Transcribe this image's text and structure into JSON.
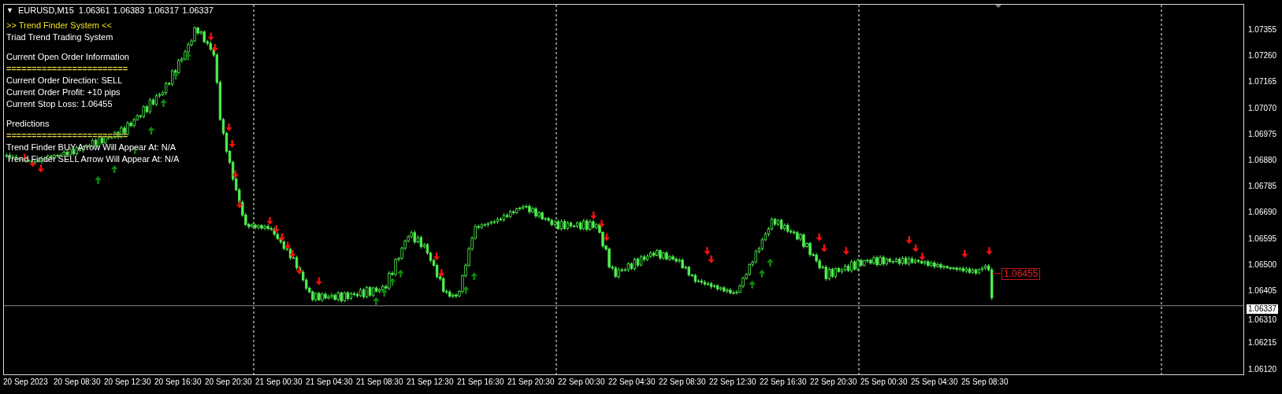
{
  "header": {
    "menu_glyph": "▼",
    "symbol": "EURUSD,M15",
    "quotes": [
      "1.06361",
      "1.06383",
      "1.06317",
      "1.06337"
    ]
  },
  "info_sections": [
    {
      "lines": [
        {
          "kind": "title",
          "text": ">> Trend Finder System <<"
        },
        {
          "kind": "text",
          "text": "Triad Trend Trading System"
        }
      ]
    },
    {
      "lines": [
        {
          "kind": "text",
          "text": "Current Open Order Information"
        },
        {
          "kind": "rule",
          "text": "========================"
        },
        {
          "kind": "text",
          "text": "Current Order Direction: SELL"
        },
        {
          "kind": "text",
          "text": "Current Order Profit: +10 pips"
        },
        {
          "kind": "text",
          "text": "Current Stop Loss: 1.06455"
        }
      ]
    },
    {
      "lines": [
        {
          "kind": "text",
          "text": "Predictions"
        },
        {
          "kind": "rule",
          "text": "========================"
        },
        {
          "kind": "text",
          "text": "Trend Finder BUY Arrow Will Appear At: N/A"
        },
        {
          "kind": "text",
          "text": "Trend Finder SELL Arrow Will Appear At: N/A"
        }
      ]
    }
  ],
  "stop_loss_label": "1.06455",
  "price_axis": {
    "ticks": [
      "1.07355",
      "1.07260",
      "1.07165",
      "1.07070",
      "1.06975",
      "1.06880",
      "1.06785",
      "1.06690",
      "1.06595",
      "1.06500",
      "1.06405",
      "1.06310",
      "1.06215",
      "1.06120"
    ],
    "current_price": "1.06337"
  },
  "time_axis": {
    "labels": [
      "20 Sep 2023",
      "20 Sep 08:30",
      "20 Sep 12:30",
      "20 Sep 16:30",
      "20 Sep 20:30",
      "21 Sep 00:30",
      "21 Sep 04:30",
      "21 Sep 08:30",
      "21 Sep 12:30",
      "21 Sep 16:30",
      "21 Sep 20:30",
      "22 Sep 00:30",
      "22 Sep 04:30",
      "22 Sep 08:30",
      "22 Sep 12:30",
      "22 Sep 16:30",
      "22 Sep 20:30",
      "25 Sep 00:30",
      "25 Sep 04:30",
      "25 Sep 08:30"
    ]
  }
}
